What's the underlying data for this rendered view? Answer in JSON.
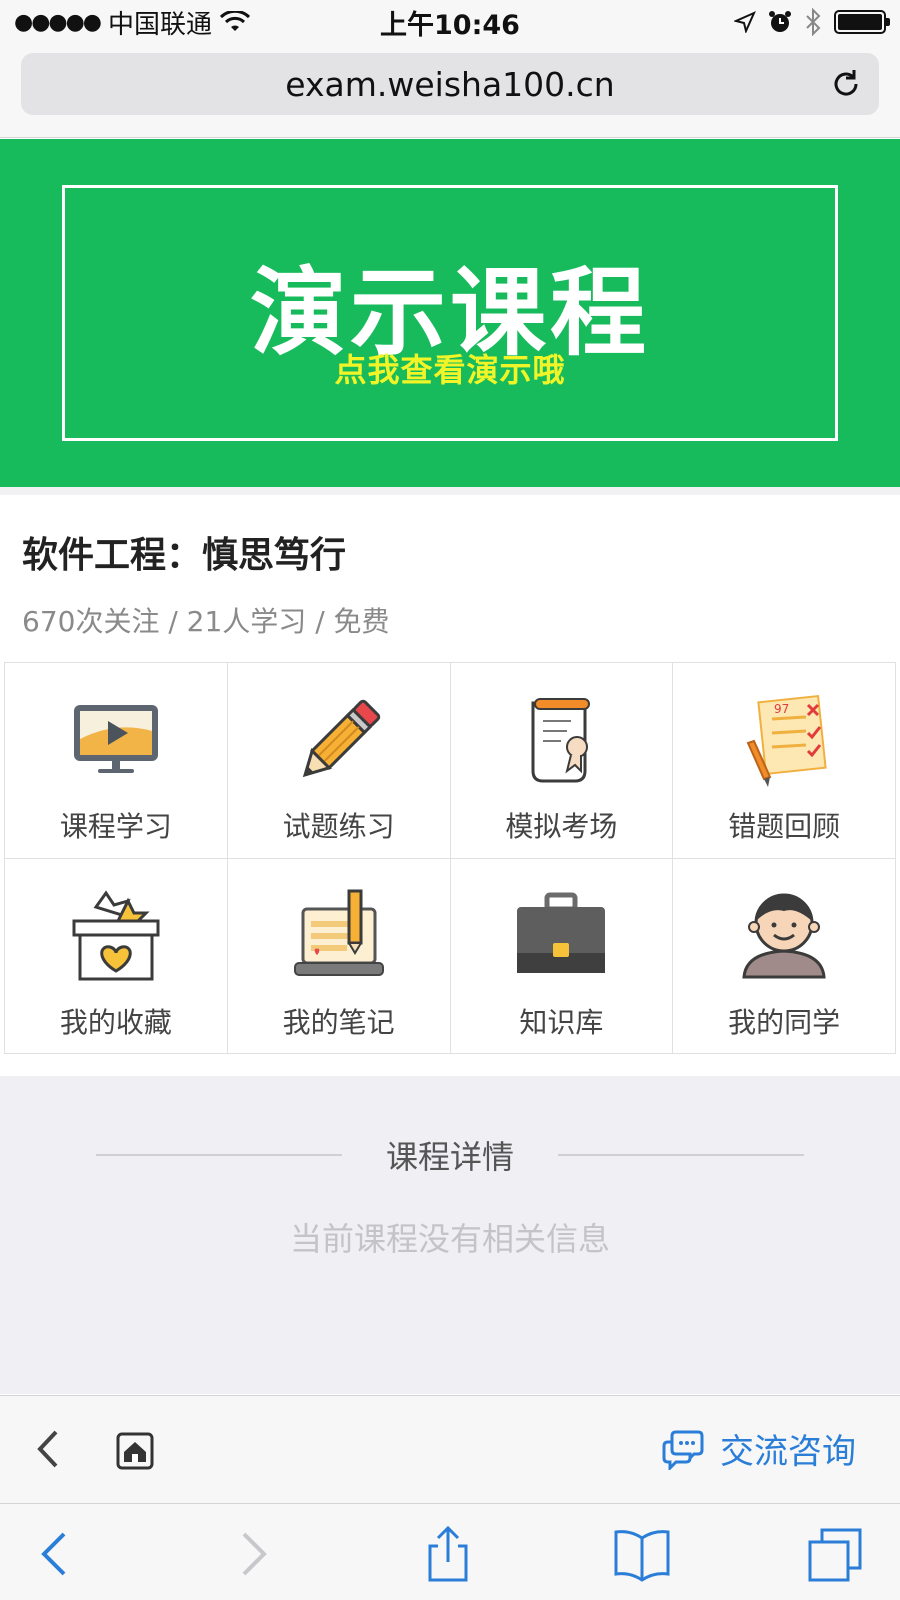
{
  "status_bar": {
    "signal": "●●●●●",
    "carrier": "中国联通",
    "time": "上午10:46"
  },
  "browser": {
    "url": "exam.weisha100.cn"
  },
  "banner": {
    "title": "演示课程",
    "subtitle": "点我查看演示哦",
    "background_color": "#18bb5c",
    "subtitle_color": "#f1f528"
  },
  "course": {
    "title": "软件工程：慎思笃行",
    "meta": "670次关注 / 21人学习 / 免费"
  },
  "grid": [
    {
      "label": "课程学习",
      "icon": "monitor-play-icon"
    },
    {
      "label": "试题练习",
      "icon": "pencil-icon"
    },
    {
      "label": "模拟考场",
      "icon": "certificate-scroll-icon"
    },
    {
      "label": "错题回顾",
      "icon": "checklist-icon"
    },
    {
      "label": "我的收藏",
      "icon": "favorite-box-icon"
    },
    {
      "label": "我的笔记",
      "icon": "notebook-laptop-icon"
    },
    {
      "label": "知识库",
      "icon": "briefcase-icon"
    },
    {
      "label": "我的同学",
      "icon": "classmate-avatar-icon"
    }
  ],
  "details": {
    "title": "课程详情",
    "empty_text": "当前课程没有相关信息"
  },
  "page_toolbar": {
    "consult_label": "交流咨询",
    "accent_color": "#2b7ed8"
  }
}
